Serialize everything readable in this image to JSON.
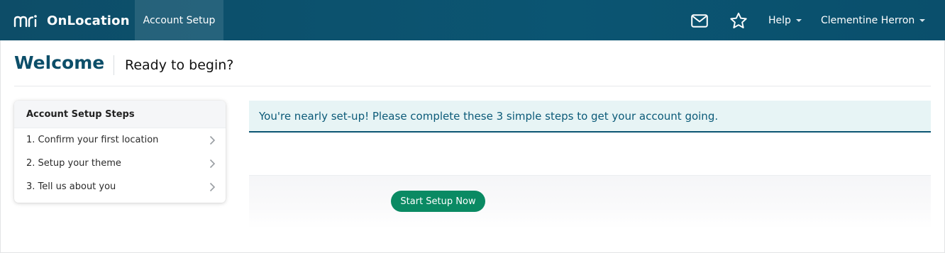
{
  "app": {
    "brand_name": "OnLocation",
    "logo_text": "mri"
  },
  "nav": {
    "active_tab": "Account Setup",
    "help_label": "Help",
    "user_name": "Clementine Herron",
    "icons": [
      "mail-icon",
      "star-icon"
    ]
  },
  "header": {
    "title": "Welcome",
    "subtitle": "Ready to begin?"
  },
  "steps": {
    "heading": "Account Setup Steps",
    "items": [
      {
        "label": "1. Confirm your first location"
      },
      {
        "label": "2. Setup your theme"
      },
      {
        "label": "3. Tell us about you"
      }
    ]
  },
  "alert": {
    "message": "You're nearly set-up! Please complete these 3 simple steps to get your account going."
  },
  "cta": {
    "label": "Start Setup Now"
  },
  "colors": {
    "nav_bg": "#0b5572",
    "title": "#0c4e69",
    "alert_bg": "#e7f4f5",
    "alert_text": "#0b5a78",
    "primary_button": "#0a8a63"
  }
}
